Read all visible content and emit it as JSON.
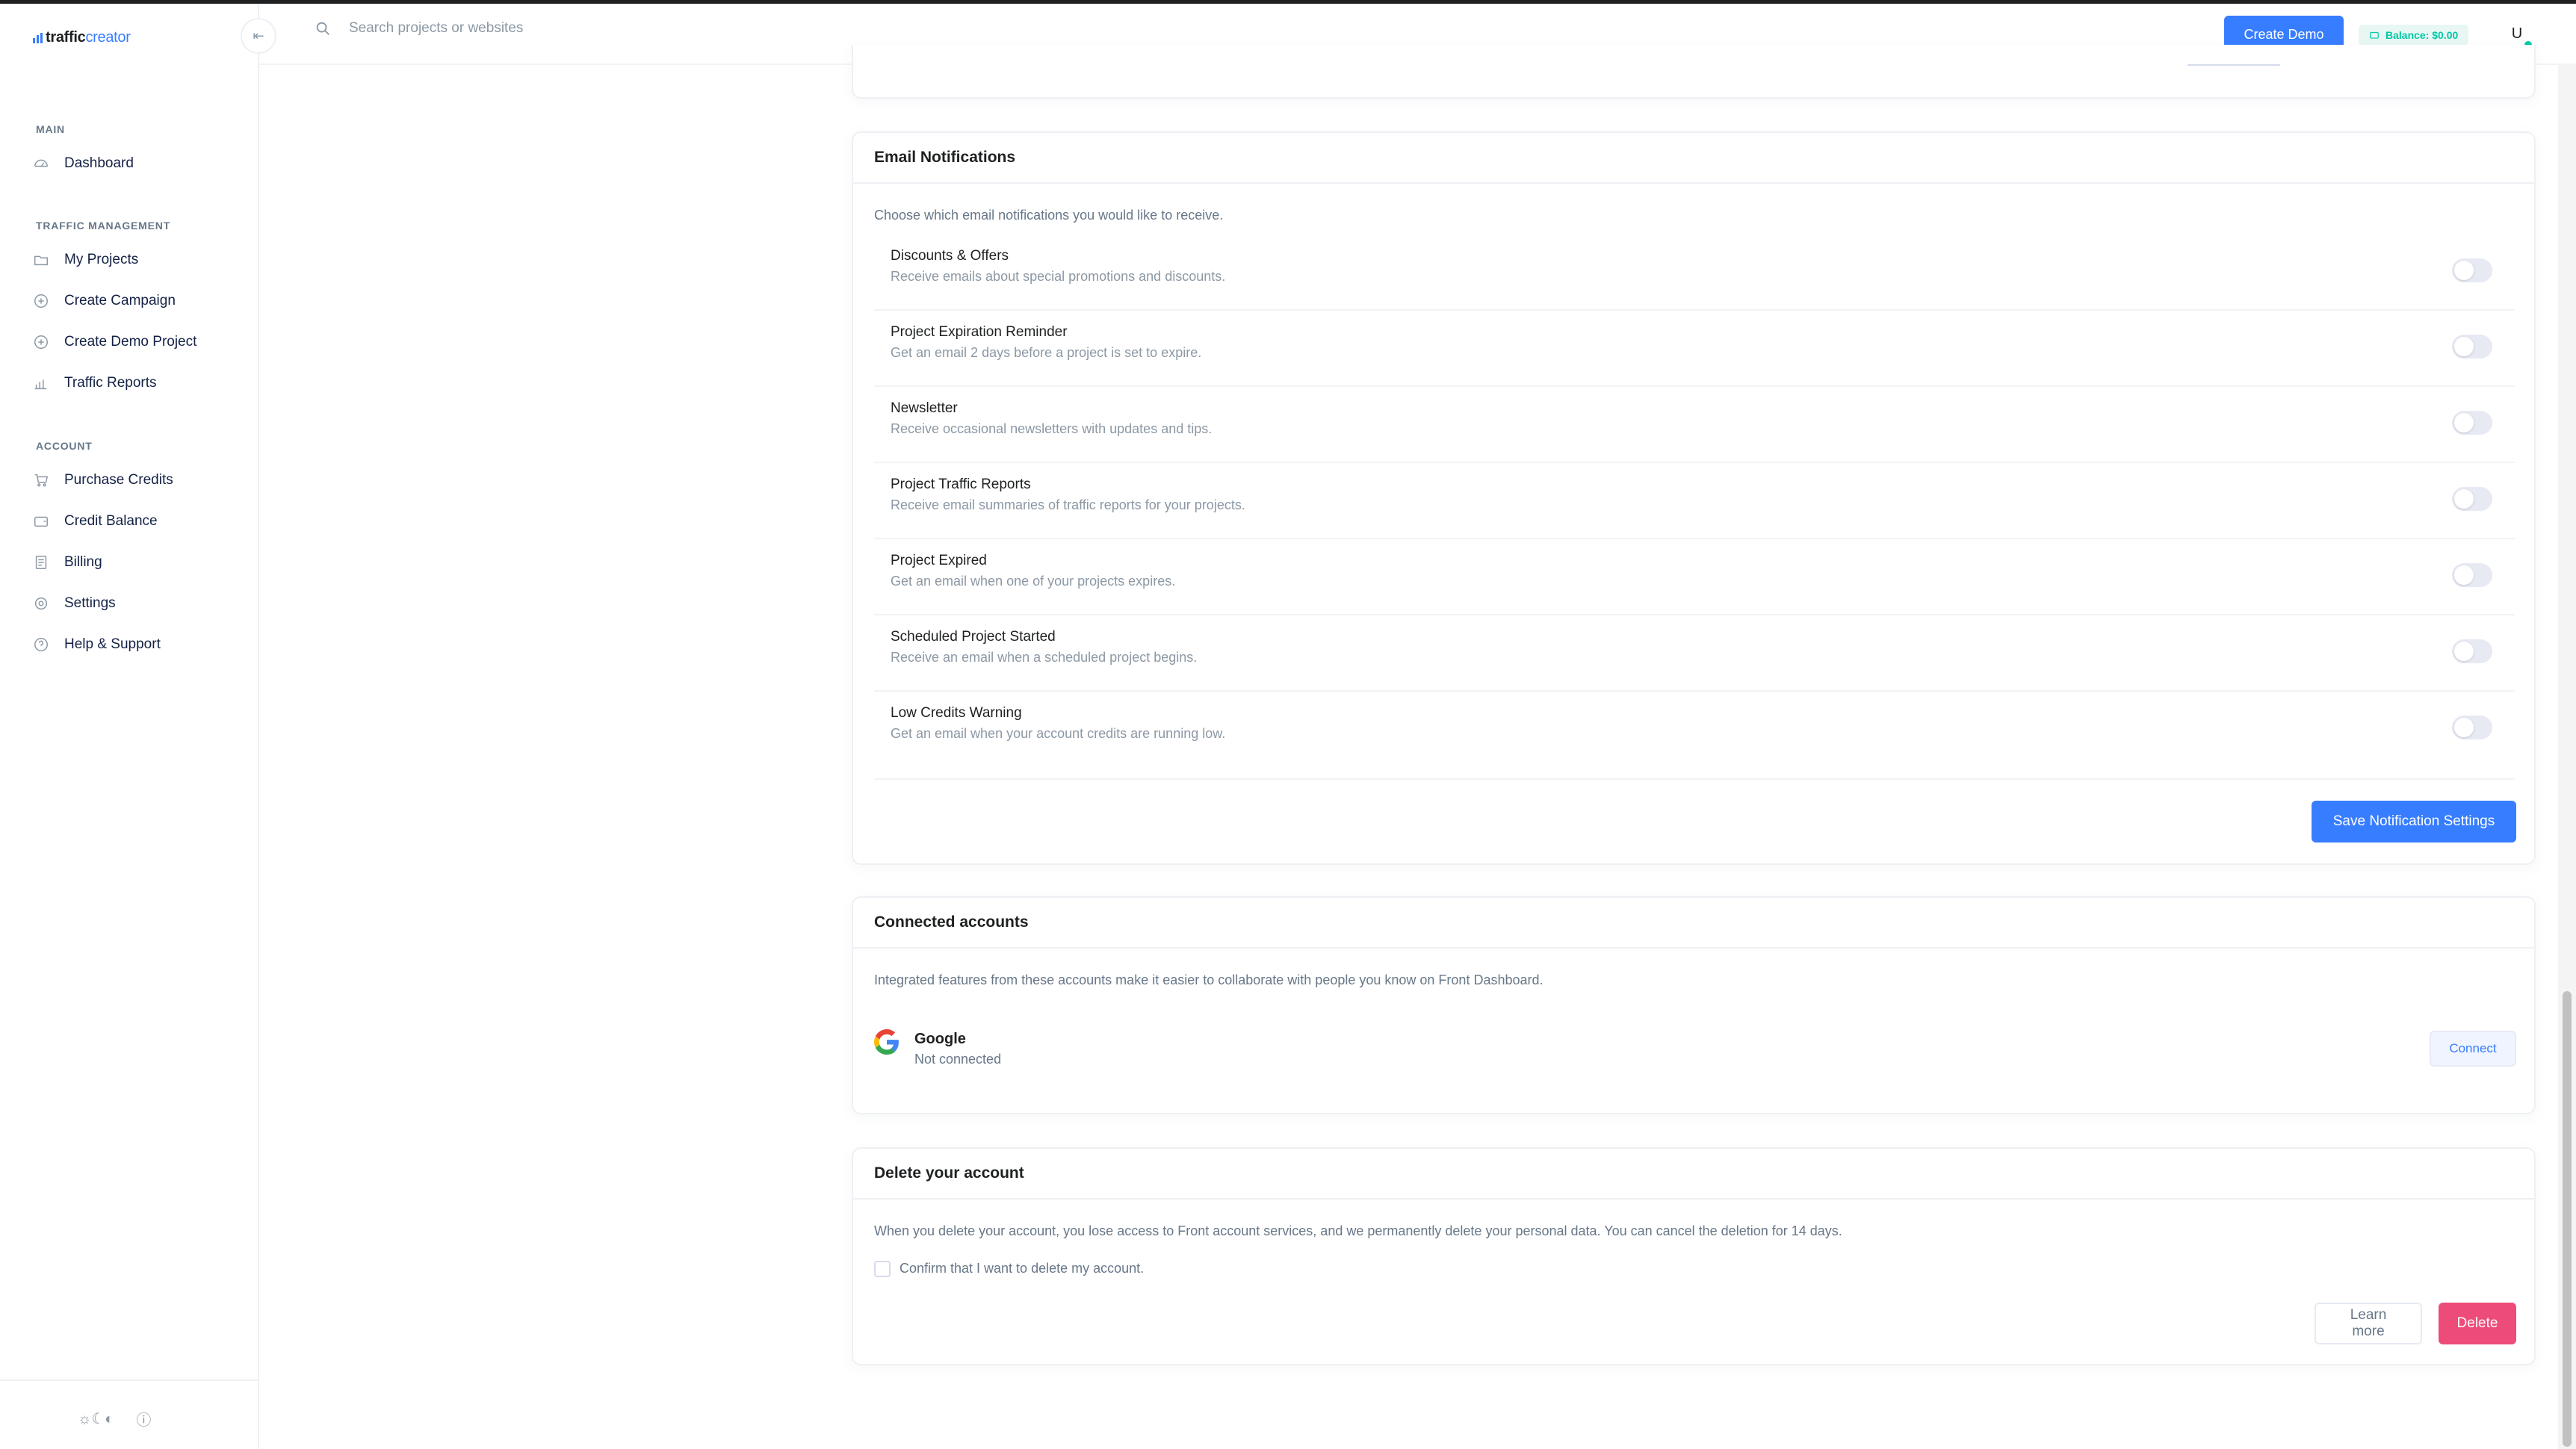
{
  "brand": {
    "name_bold": "traffic",
    "name_light": "creator",
    "accent": "#377dff"
  },
  "topbar": {
    "search_placeholder": "Search projects or websites",
    "create_demo_label": "Create Demo",
    "balance_label": "Balance: $0.00",
    "avatar_initial": "U"
  },
  "sidebar": {
    "sections": [
      {
        "title": "MAIN",
        "items": [
          {
            "label": "Dashboard",
            "icon": "dashboard-icon"
          }
        ]
      },
      {
        "title": "TRAFFIC MANAGEMENT",
        "items": [
          {
            "label": "My Projects",
            "icon": "folder-icon"
          },
          {
            "label": "Create Campaign",
            "icon": "plus-circle-icon"
          },
          {
            "label": "Create Demo Project",
            "icon": "plus-circle-icon"
          },
          {
            "label": "Traffic Reports",
            "icon": "bar-chart-icon"
          }
        ]
      },
      {
        "title": "ACCOUNT",
        "items": [
          {
            "label": "Purchase Credits",
            "icon": "cart-icon"
          },
          {
            "label": "Credit Balance",
            "icon": "wallet-icon"
          },
          {
            "label": "Billing",
            "icon": "receipt-icon"
          },
          {
            "label": "Settings",
            "icon": "gear-icon"
          },
          {
            "label": "Help & Support",
            "icon": "help-circle-icon"
          }
        ]
      }
    ]
  },
  "email_notifications": {
    "title": "Email Notifications",
    "description": "Choose which email notifications you would like to receive.",
    "items": [
      {
        "title": "Discounts & Offers",
        "subtitle": "Receive emails about special promotions and discounts."
      },
      {
        "title": "Project Expiration Reminder",
        "subtitle": "Get an email 2 days before a project is set to expire."
      },
      {
        "title": "Newsletter",
        "subtitle": "Receive occasional newsletters with updates and tips."
      },
      {
        "title": "Project Traffic Reports",
        "subtitle": "Receive email summaries of traffic reports for your projects."
      },
      {
        "title": "Project Expired",
        "subtitle": "Get an email when one of your projects expires."
      },
      {
        "title": "Scheduled Project Started",
        "subtitle": "Receive an email when a scheduled project begins."
      },
      {
        "title": "Low Credits Warning",
        "subtitle": "Get an email when your account credits are running low."
      }
    ],
    "save_label": "Save Notification Settings"
  },
  "connected_accounts": {
    "title": "Connected accounts",
    "description": "Integrated features from these accounts make it easier to collaborate with people you know on Front Dashboard.",
    "google_name": "Google",
    "google_status": "Not connected",
    "connect_label": "Connect"
  },
  "delete_account": {
    "title": "Delete your account",
    "description": "When you delete your account, you lose access to Front account services, and we permanently delete your personal data. You can cancel the deletion for 14 days.",
    "confirm_label": "Confirm that I want to delete my account.",
    "learn_more_label": "Learn more",
    "delete_label": "Delete"
  }
}
